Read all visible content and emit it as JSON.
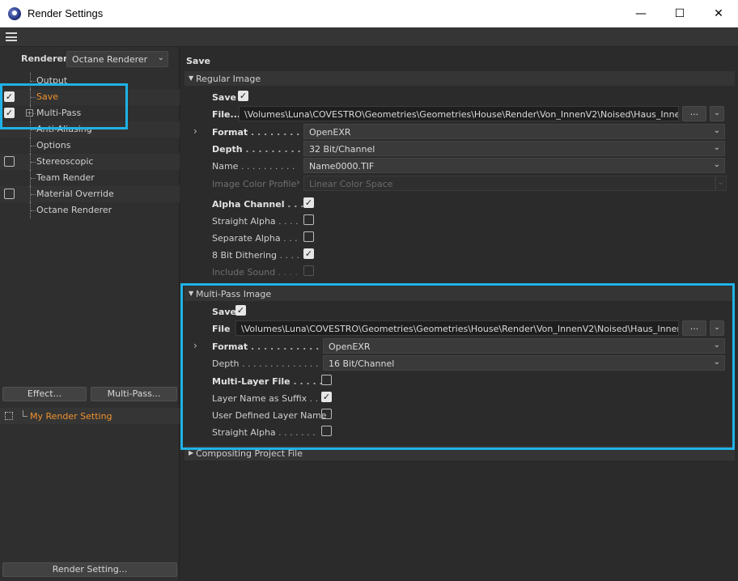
{
  "window": {
    "title": "Render Settings",
    "minimize": "—",
    "maximize": "☐",
    "close": "✕"
  },
  "left": {
    "renderer_label": "Renderer",
    "renderer_value": "Octane Renderer",
    "tree": [
      {
        "label": "Output",
        "checkbox": false,
        "checked": false,
        "active": false
      },
      {
        "label": "Save",
        "checkbox": true,
        "checked": true,
        "active": true
      },
      {
        "label": "Multi-Pass",
        "checkbox": true,
        "checked": true,
        "active": false,
        "expander": true
      },
      {
        "label": "Anti-Aliasing",
        "checkbox": false,
        "checked": false,
        "active": false
      },
      {
        "label": "Options",
        "checkbox": false,
        "checked": false,
        "active": false
      },
      {
        "label": "Stereoscopic",
        "checkbox": true,
        "checked": false,
        "active": false
      },
      {
        "label": "Team Render",
        "checkbox": false,
        "checked": false,
        "active": false
      },
      {
        "label": "Material Override",
        "checkbox": true,
        "checked": false,
        "active": false
      },
      {
        "label": "Octane Renderer",
        "checkbox": false,
        "checked": false,
        "active": false
      }
    ],
    "effect_button": "Effect...",
    "multipass_button": "Multi-Pass...",
    "setting_name": "My Render Setting",
    "render_setting_button": "Render Setting..."
  },
  "right": {
    "title": "Save",
    "regular": {
      "header": "Regular Image",
      "save_label": "Save",
      "save_checked": true,
      "file_label": "File...",
      "file_value": "\\Volumes\\Luna\\COVESTRO\\Geometries\\Geometries\\House\\Render\\Von_InnenV2\\Noised\\Haus_Innen",
      "browse": "...",
      "format_label": "Format",
      "format_value": "OpenEXR",
      "depth_label": "Depth",
      "depth_value": "32 Bit/Channel",
      "name_label": "Name",
      "name_value": "Name0000.TIF",
      "profile_label": "Image Color Profile",
      "profile_value": "Linear Color Space",
      "alpha_label": "Alpha Channel",
      "alpha_checked": true,
      "straight_label": "Straight Alpha",
      "straight_checked": false,
      "separate_label": "Separate Alpha",
      "separate_checked": false,
      "dither_label": "8 Bit Dithering",
      "dither_checked": true,
      "sound_label": "Include Sound",
      "sound_checked": false
    },
    "multipass": {
      "header": "Multi-Pass Image",
      "save_label": "Save",
      "save_checked": true,
      "file_label": "File",
      "file_value": "\\Volumes\\Luna\\COVESTRO\\Geometries\\Geometries\\House\\Render\\Von_InnenV2\\Noised\\Haus_Innen",
      "browse": "...",
      "format_label": "Format",
      "format_value": "OpenEXR",
      "depth_label": "Depth",
      "depth_value": "16 Bit/Channel",
      "multilayer_label": "Multi-Layer File",
      "multilayer_checked": false,
      "suffix_label": "Layer Name as Suffix",
      "suffix_checked": true,
      "userdef_label": "User Defined Layer Name",
      "userdef_checked": false,
      "straight_label": "Straight Alpha",
      "straight_checked": false
    },
    "compositing": {
      "header": "Compositing Project File"
    }
  },
  "highlight_color": "#1fb2e6",
  "accent_color": "#f0922d"
}
